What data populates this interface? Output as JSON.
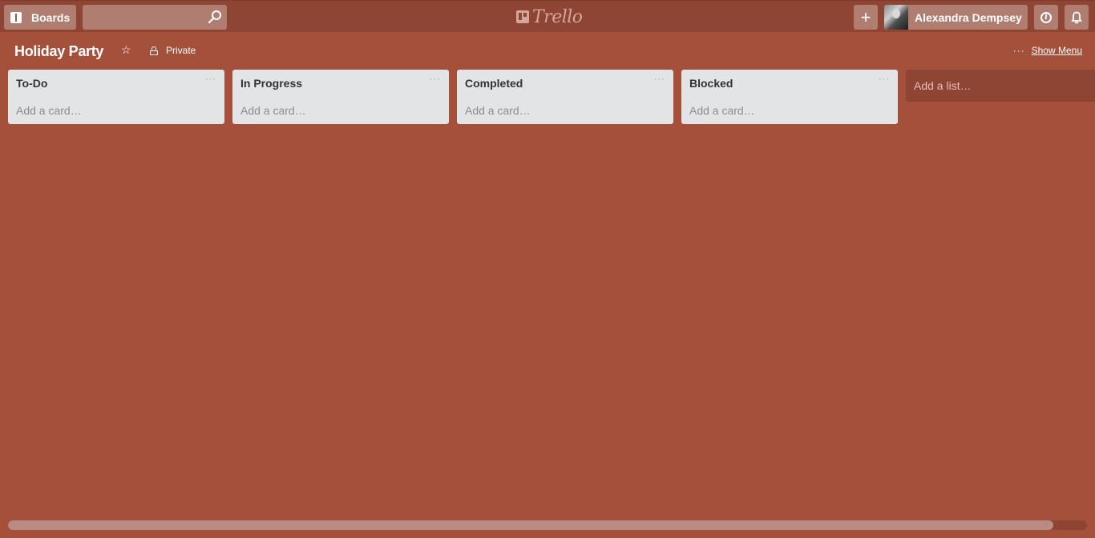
{
  "header": {
    "boards_label": "Boards",
    "search_placeholder": "",
    "logo_text": "Trello",
    "add_icon": "+",
    "member_name": "Alexandra Dempsey",
    "info_icon": "i",
    "icons": {
      "boards": "boards-icon",
      "search": "search-icon",
      "add": "plus-icon",
      "info": "info-icon",
      "notifications": "bell-icon"
    }
  },
  "board": {
    "title": "Holiday Party",
    "star_glyph": "☆",
    "visibility": "Private",
    "menu_dots": "···",
    "show_menu_label": "Show Menu"
  },
  "lists": [
    {
      "name": "To-Do",
      "menu": "···",
      "add_card": "Add a card…"
    },
    {
      "name": "In Progress",
      "menu": "···",
      "add_card": "Add a card…"
    },
    {
      "name": "Completed",
      "menu": "···",
      "add_card": "Add a card…"
    },
    {
      "name": "Blocked",
      "menu": "···",
      "add_card": "Add a card…"
    }
  ],
  "add_list_label": "Add a list…",
  "colors": {
    "board_background": "#a5503b",
    "header_background": "#8f4534",
    "list_background": "#e2e4e6"
  },
  "scroll": {
    "horizontal_visible_fraction": 0.97
  }
}
